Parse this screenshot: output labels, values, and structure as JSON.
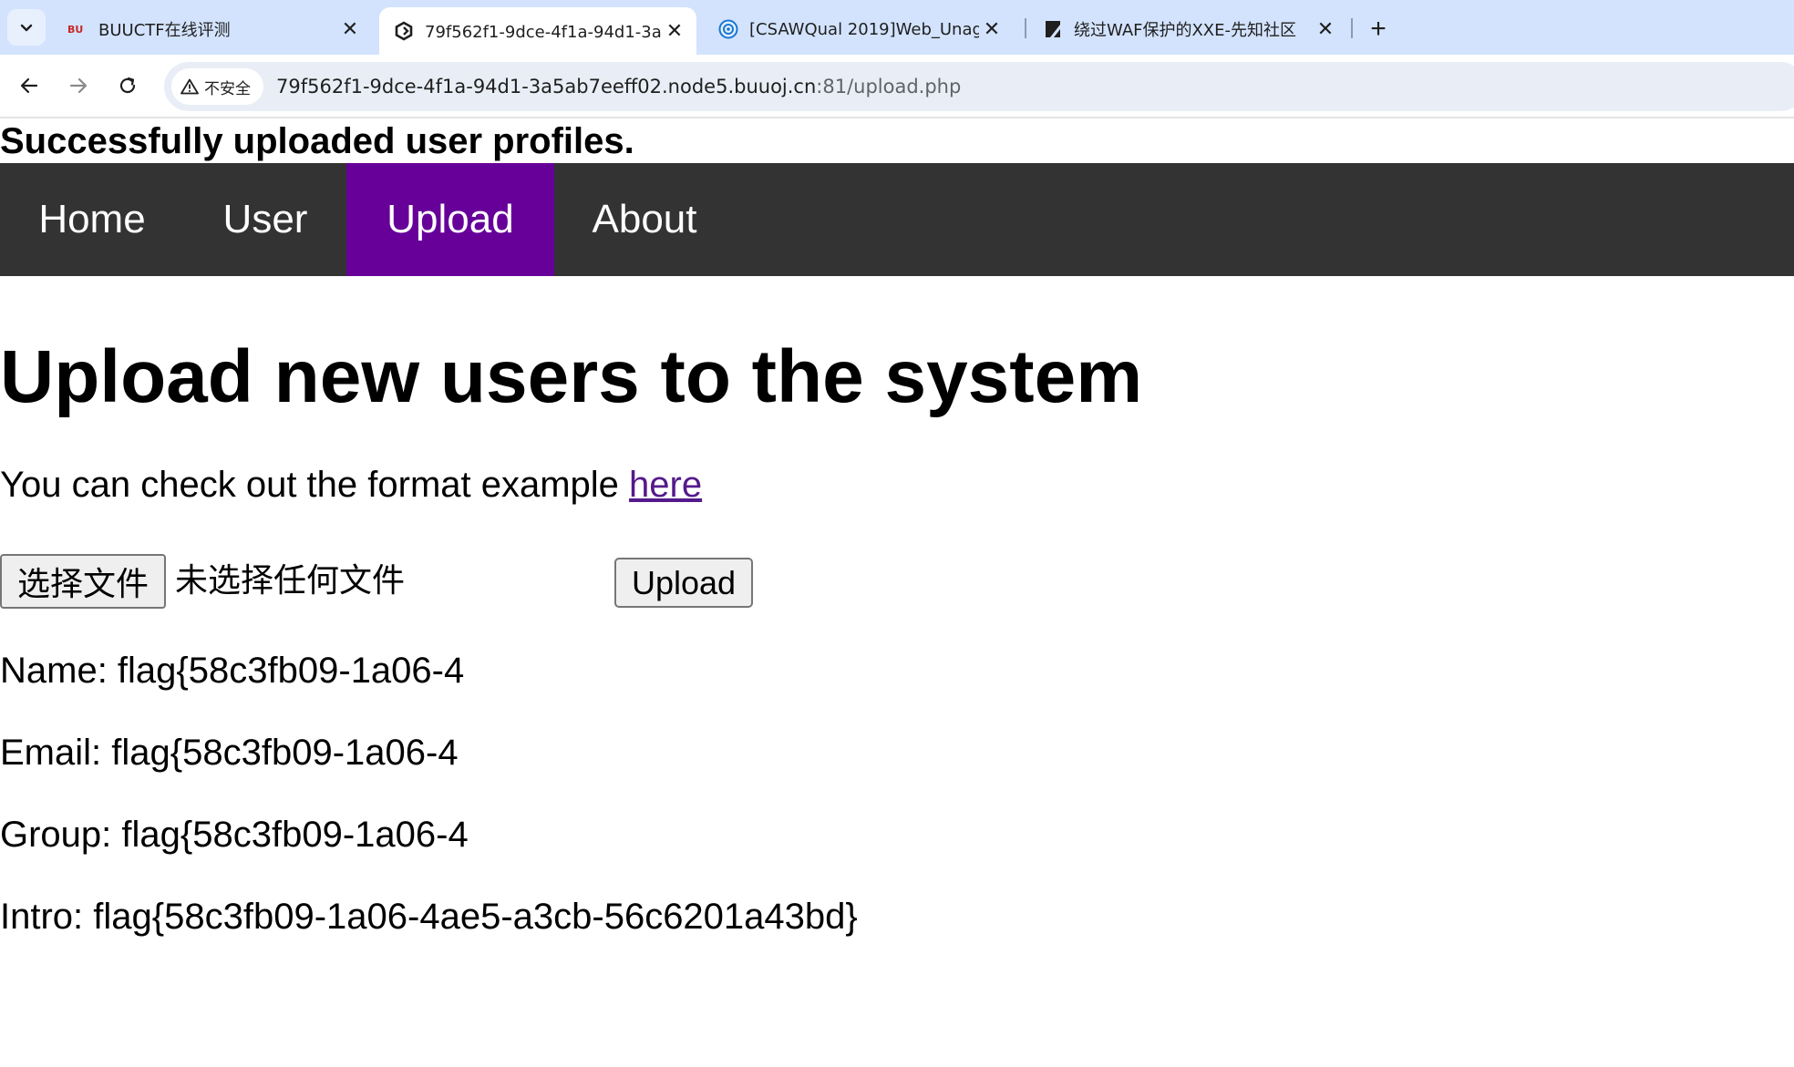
{
  "browser": {
    "tabs": [
      {
        "title": "BUUCTF在线评测",
        "favicon": "buuctf-favicon",
        "active": false
      },
      {
        "title": "79f562f1-9dce-4f1a-94d1-3a",
        "favicon": "buuoj-favicon",
        "active": true
      },
      {
        "title": "[CSAWQual 2019]Web_Unag",
        "favicon": "globe-favicon",
        "active": false
      },
      {
        "title": "绕过WAF保护的XXE-先知社区",
        "favicon": "xianzhi-favicon",
        "active": false
      }
    ],
    "security_label": "不安全",
    "url_host": "79f562f1-9dce-4f1a-94d1-3a5ab7eeff02.node5.buuoj.cn",
    "url_path": ":81/upload.php"
  },
  "page": {
    "success_message": "Successfully uploaded user profiles.",
    "nav": [
      {
        "label": "Home",
        "active": false
      },
      {
        "label": "User",
        "active": false
      },
      {
        "label": "Upload",
        "active": true
      },
      {
        "label": "About",
        "active": false
      }
    ],
    "heading": "Upload new users to the system",
    "format_text": "You can check out the format example ",
    "format_link": "here",
    "file_button_label": "选择文件",
    "file_status": "未选择任何文件",
    "upload_button_label": "Upload",
    "results": [
      "Name: flag{58c3fb09-1a06-4",
      "Email: flag{58c3fb09-1a06-4",
      "Group: flag{58c3fb09-1a06-4",
      "Intro: flag{58c3fb09-1a06-4ae5-a3cb-56c6201a43bd}"
    ]
  },
  "colors": {
    "tabstrip": "#d3e3fd",
    "navbar": "#333333",
    "nav_active": "#660099",
    "link_visited": "#551a8b"
  }
}
